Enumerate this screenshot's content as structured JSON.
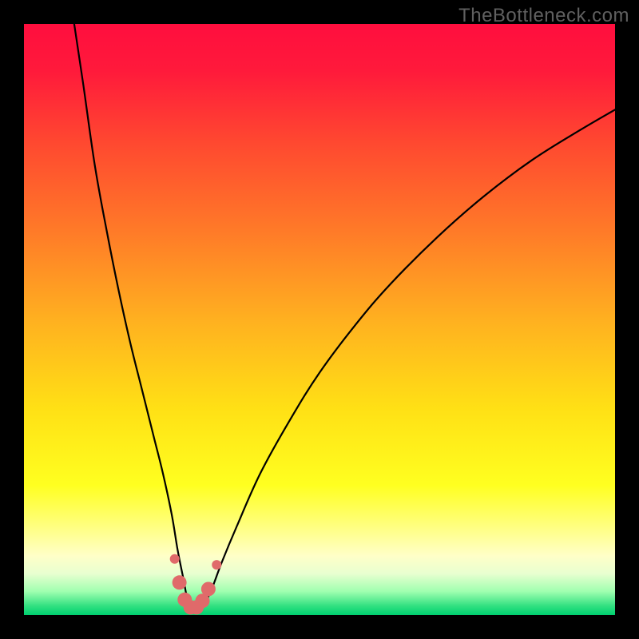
{
  "watermark": "TheBottleneck.com",
  "chart_data": {
    "type": "line",
    "title": "",
    "xlabel": "",
    "ylabel": "",
    "xlim": [
      0,
      100
    ],
    "ylim": [
      0,
      100
    ],
    "background_gradient": {
      "stops": [
        {
          "offset": 0.0,
          "color": "#ff0e3e"
        },
        {
          "offset": 0.08,
          "color": "#ff1a3b"
        },
        {
          "offset": 0.2,
          "color": "#ff4830"
        },
        {
          "offset": 0.35,
          "color": "#ff7a28"
        },
        {
          "offset": 0.5,
          "color": "#ffb020"
        },
        {
          "offset": 0.65,
          "color": "#ffe015"
        },
        {
          "offset": 0.78,
          "color": "#ffff20"
        },
        {
          "offset": 0.85,
          "color": "#ffff80"
        },
        {
          "offset": 0.9,
          "color": "#ffffc8"
        },
        {
          "offset": 0.93,
          "color": "#e8ffd0"
        },
        {
          "offset": 0.96,
          "color": "#a0ffb0"
        },
        {
          "offset": 0.985,
          "color": "#30e080"
        },
        {
          "offset": 1.0,
          "color": "#00d070"
        }
      ]
    },
    "series": [
      {
        "name": "bottleneck-curve",
        "color": "#000000",
        "width": 2.2,
        "x": [
          8.5,
          10,
          12,
          14,
          16,
          18,
          20,
          22,
          23.5,
          25,
          26,
          27,
          27.7,
          28.5,
          29.5,
          31,
          32,
          33.5,
          36,
          40,
          45,
          50,
          56,
          62,
          70,
          78,
          86,
          94,
          100
        ],
        "values": [
          100,
          90,
          76,
          65,
          55,
          46,
          38,
          30,
          24,
          17,
          11,
          6,
          2.5,
          1.2,
          1.2,
          2.8,
          5,
          9,
          15,
          24,
          33,
          41,
          49,
          56,
          64,
          71,
          77,
          82,
          85.5
        ]
      }
    ],
    "markers": {
      "name": "valley-markers",
      "color": "#e06a6a",
      "radius_main": 9,
      "radius_small": 6,
      "points": [
        {
          "x": 25.5,
          "y": 9.5,
          "r": "small"
        },
        {
          "x": 26.3,
          "y": 5.5,
          "r": "main"
        },
        {
          "x": 27.2,
          "y": 2.6,
          "r": "main"
        },
        {
          "x": 28.2,
          "y": 1.3,
          "r": "main"
        },
        {
          "x": 29.2,
          "y": 1.3,
          "r": "main"
        },
        {
          "x": 30.2,
          "y": 2.4,
          "r": "main"
        },
        {
          "x": 31.2,
          "y": 4.4,
          "r": "main"
        },
        {
          "x": 32.6,
          "y": 8.5,
          "r": "small"
        }
      ]
    }
  }
}
